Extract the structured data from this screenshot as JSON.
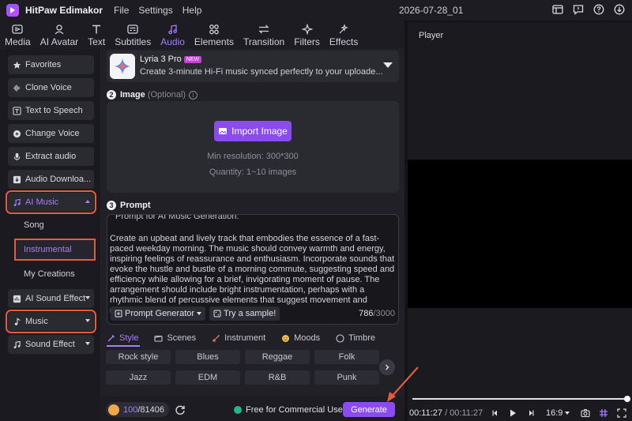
{
  "app": {
    "title": "HitPaw Edimakor",
    "menu": [
      "File",
      "Settings",
      "Help"
    ],
    "project_name": "2026-07-28_01"
  },
  "tabs": [
    {
      "label": "Media",
      "icon": "media-icon"
    },
    {
      "label": "AI Avatar",
      "icon": "ai-avatar-icon"
    },
    {
      "label": "Text",
      "icon": "text-icon"
    },
    {
      "label": "Subtitles",
      "icon": "subtitles-icon"
    },
    {
      "label": "Audio",
      "icon": "audio-icon",
      "active": true
    },
    {
      "label": "Elements",
      "icon": "elements-icon"
    },
    {
      "label": "Transition",
      "icon": "transition-icon"
    },
    {
      "label": "Filters",
      "icon": "filters-icon"
    },
    {
      "label": "Effects",
      "icon": "effects-icon"
    }
  ],
  "sidebar": {
    "items": [
      {
        "label": "Favorites",
        "icon": "star-icon"
      },
      {
        "label": "Clone Voice",
        "icon": "waveform-icon"
      },
      {
        "label": "Text to Speech",
        "icon": "text-speech-icon"
      },
      {
        "label": "Change Voice",
        "icon": "voice-icon"
      },
      {
        "label": "Extract audio",
        "icon": "microphone-icon"
      },
      {
        "label": "Audio Downloa...",
        "icon": "download-icon"
      },
      {
        "label": "AI Music",
        "icon": "ai-music-icon",
        "expanded": true
      },
      {
        "label": "AI Sound Effect",
        "icon": "ai-sound-icon"
      },
      {
        "label": "Music",
        "icon": "music-note-icon"
      },
      {
        "label": "Sound Effect",
        "icon": "sound-effect-icon"
      }
    ],
    "sub_items": [
      "Song",
      "Instrumental",
      "My Creations"
    ]
  },
  "model": {
    "name": "Lyria 3 Pro",
    "badge": "NEW",
    "description": "Create 3-minute Hi-Fi music synced perfectly to your uploade..."
  },
  "image_section": {
    "step": "2",
    "title": "Image",
    "optional": "(Optional)",
    "import_label": "Import Image",
    "min_resolution": "Min resolution: 300*300",
    "quantity": "Quantity: 1~10 images"
  },
  "prompt_section": {
    "step": "3",
    "title": "Prompt",
    "head": "Prompt for AI Music Generation:",
    "text": "Create an upbeat and lively track that embodies the essence of a fast-paced weekday morning. The music should convey warmth and energy, inspiring feelings of reassurance and enthusiasm. Incorporate sounds that evoke the hustle and bustle of a morning commute, suggesting speed and efficiency while allowing for a brief, invigorating moment of pause. The arrangement should include bright instrumentation, perhaps with a rhythmic blend of percussive elements that suggest movement and momentum, layering in",
    "generator_label": "Prompt Generator",
    "sample_label": "Try a sample!",
    "char_count": "786",
    "char_max": "/3000"
  },
  "style_tabs": [
    {
      "label": "Style",
      "icon": "style-icon",
      "active": true
    },
    {
      "label": "Scenes",
      "icon": "scenes-icon"
    },
    {
      "label": "Instrument",
      "icon": "instrument-icon"
    },
    {
      "label": "Moods",
      "icon": "moods-icon"
    },
    {
      "label": "Timbre",
      "icon": "timbre-icon"
    }
  ],
  "genres": [
    "Rock style",
    "Blues",
    "Reggae",
    "Folk",
    "Jazz",
    "EDM",
    "R&B",
    "Punk"
  ],
  "bottom": {
    "credits_current": "100",
    "credits_total": "/81406",
    "commercial": "Free for Commercial Use",
    "generate_label": "Generate"
  },
  "player": {
    "title": "Player",
    "current_time": "00:11:27",
    "total_time": "/ 00:11:27",
    "aspect_ratio": "16:9",
    "progress": 1.0
  },
  "colors": {
    "accent": "#a87dff",
    "button": "#8a4cf0",
    "highlight": "#e55b3c"
  }
}
